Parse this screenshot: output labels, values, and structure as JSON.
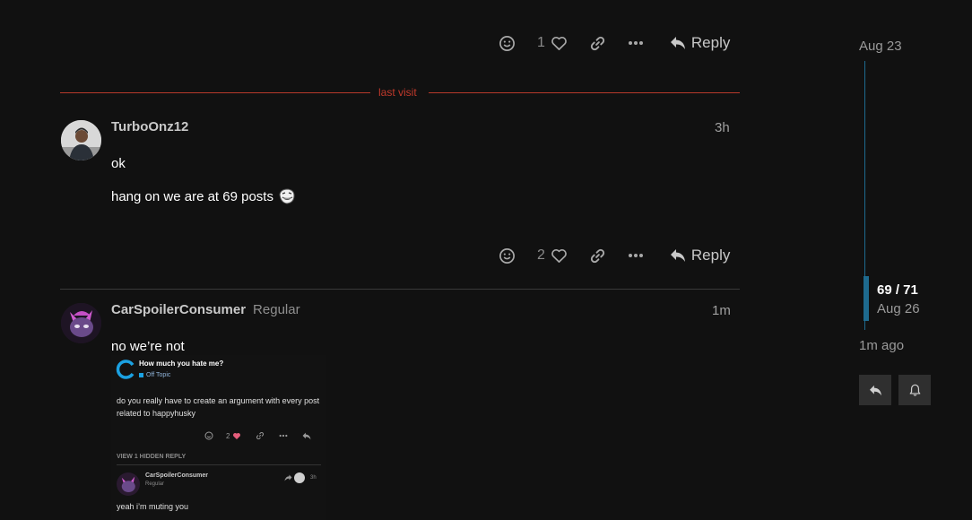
{
  "top_actions": {
    "like_count": "1",
    "reply_label": "Reply"
  },
  "last_visit": {
    "label": "last visit"
  },
  "post1": {
    "username": "TurboOnz12",
    "time": "3h",
    "lines": [
      "ok",
      "hang on we are at 69 posts"
    ],
    "like_count": "2",
    "reply_label": "Reply"
  },
  "post2": {
    "username": "CarSpoilerConsumer",
    "user_title": "Regular",
    "time": "1m",
    "text": "no we’re not",
    "embedded": {
      "topic_title": "How much you hate me?",
      "category": "Off Topic",
      "body": "do you really have to create an argument with every post related to happyhusky",
      "like_count": "2",
      "hidden_replies": "VIEW 1 HIDDEN REPLY",
      "reply_user": "CarSpoilerConsumer",
      "reply_title": "Regular",
      "reply_time": "3h",
      "reply_text": "yeah i’m muting you"
    }
  },
  "timeline": {
    "start_date": "Aug 23",
    "position": "69 / 71",
    "current_date": "Aug 26",
    "last_activity": "1m ago"
  },
  "colors": {
    "accent": "#1e6a8e",
    "last_visit": "#c0392b",
    "like_heart": "#e45d7b"
  }
}
